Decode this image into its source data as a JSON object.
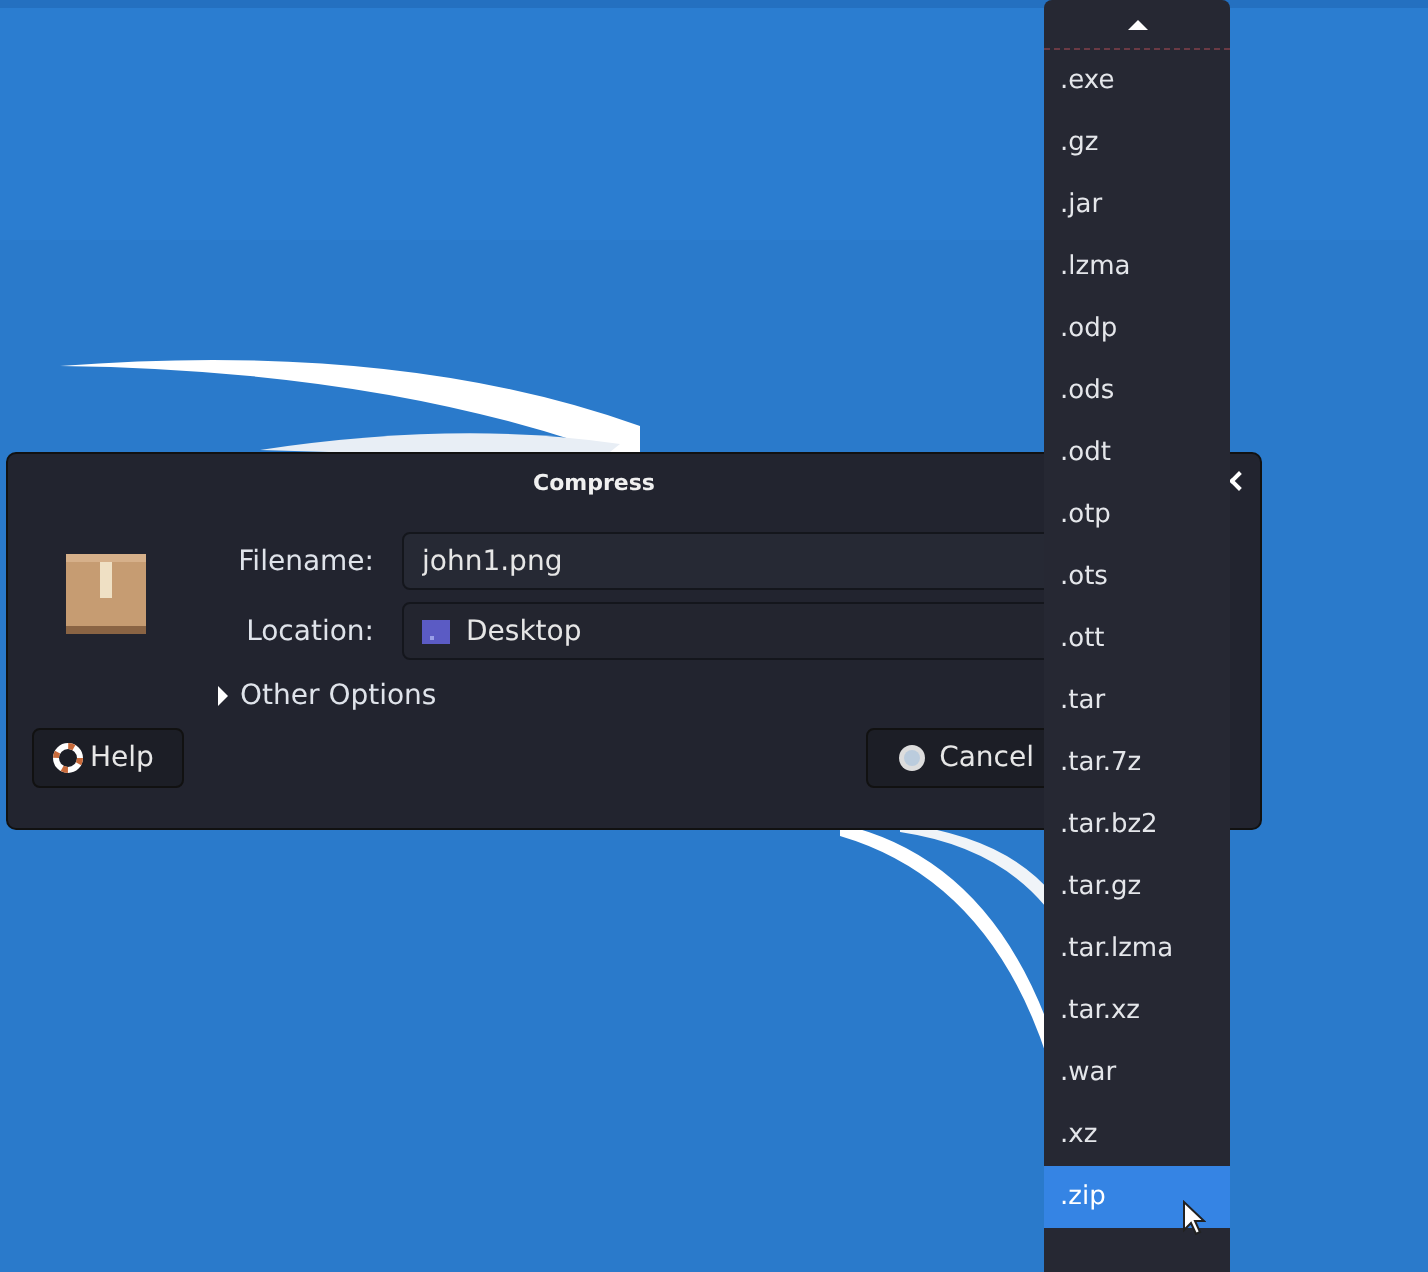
{
  "dialog": {
    "title": "Compress",
    "filename_label": "Filename:",
    "filename": "john1.png",
    "location_label": "Location:",
    "location": "Desktop",
    "other_options": "Other Options",
    "expanded": false,
    "help_button": "Help",
    "cancel_button": "Cancel"
  },
  "format_menu": {
    "items": [
      {
        "label": ".exe",
        "selected": false
      },
      {
        "label": ".gz",
        "selected": false
      },
      {
        "label": ".jar",
        "selected": false
      },
      {
        "label": ".lzma",
        "selected": false
      },
      {
        "label": ".odp",
        "selected": false
      },
      {
        "label": ".ods",
        "selected": false
      },
      {
        "label": ".odt",
        "selected": false
      },
      {
        "label": ".otp",
        "selected": false
      },
      {
        "label": ".ots",
        "selected": false
      },
      {
        "label": ".ott",
        "selected": false
      },
      {
        "label": ".tar",
        "selected": false
      },
      {
        "label": ".tar.7z",
        "selected": false
      },
      {
        "label": ".tar.bz2",
        "selected": false
      },
      {
        "label": ".tar.gz",
        "selected": false
      },
      {
        "label": ".tar.lzma",
        "selected": false
      },
      {
        "label": ".tar.xz",
        "selected": false
      },
      {
        "label": ".war",
        "selected": false
      },
      {
        "label": ".xz",
        "selected": false
      },
      {
        "label": ".zip",
        "selected": true
      }
    ]
  }
}
